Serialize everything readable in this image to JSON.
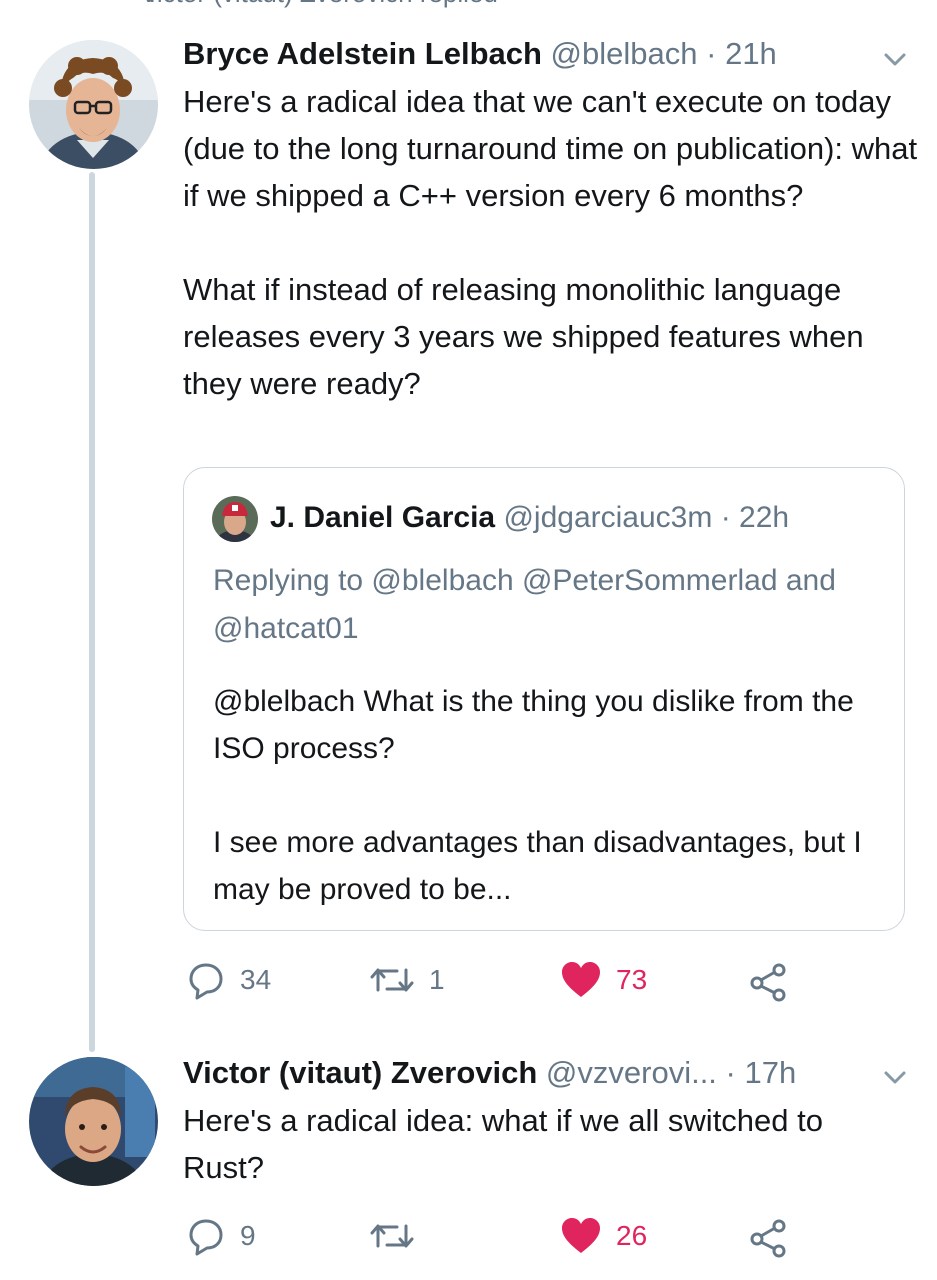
{
  "context": {
    "text": "Victor (vitaut) Zverovich replied",
    "icon": "reply-arrow-icon"
  },
  "tweet1": {
    "name": "Bryce Adelstein Lelbach",
    "handle": "@blelbach",
    "sep": "·",
    "time": "21h",
    "paragraphs": [
      "Here's a radical idea that we can't execute on today (due to the long turnaround time on publication): what if we shipped a C++ version every 6 months?",
      "What if instead of releasing monolithic language releases every 3 years we shipped features when they were ready?"
    ],
    "quote": {
      "name": "J. Daniel Garcia",
      "handle": "@jdgarciauc3m",
      "sep": "·",
      "time": "22h",
      "replying_to": "Replying to @blelbach @PeterSommerlad and @hatcat01",
      "paragraphs": [
        "@blelbach  What is the thing you dislike from the ISO process?",
        "I see more advantages than disadvantages, but I may be proved to be..."
      ]
    },
    "actions": {
      "replies": "34",
      "retweets": "1",
      "likes": "73"
    }
  },
  "tweet2": {
    "name": "Victor (vitaut) Zverovich",
    "handle": "@vzverovi...",
    "sep": "·",
    "time": "17h",
    "text": "Here's a radical idea: what if we all switched to Rust?",
    "actions": {
      "replies": "9",
      "retweets": "",
      "likes": "26"
    }
  },
  "colors": {
    "like": "#e0245e",
    "muted": "#657786",
    "border": "#ccd6dd",
    "text": "#14171a"
  }
}
